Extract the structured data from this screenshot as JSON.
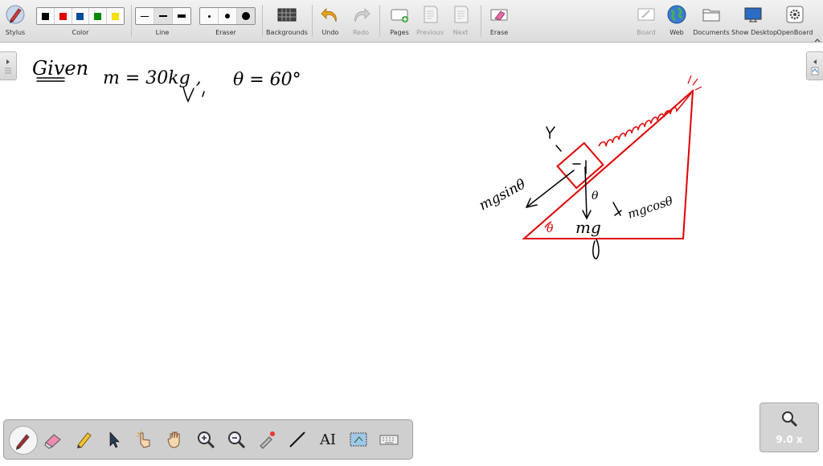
{
  "toolbar": {
    "stylus_label": "Stylus",
    "color_label": "Color",
    "line_label": "Line",
    "eraser_label": "Eraser",
    "backgrounds_label": "Backgrounds",
    "undo_label": "Undo",
    "redo_label": "Redo",
    "pages_label": "Pages",
    "previous_label": "Previous",
    "next_label": "Next",
    "erase_label": "Erase",
    "board_label": "Board",
    "web_label": "Web",
    "documents_label": "Documents",
    "show_desktop_label": "Show Desktop",
    "openboard_label": "OpenBoard",
    "colors": [
      "#000000",
      "#e00000",
      "#004c99",
      "#008a00",
      "#f5e000"
    ],
    "selected_color": "#000000"
  },
  "zoom": {
    "value": "9.0 x",
    "icon": "zoom-magnifier-icon"
  },
  "bottom_tools": [
    {
      "name": "pen-tool",
      "icon": "pen-icon"
    },
    {
      "name": "eraser-tool",
      "icon": "eraser-icon"
    },
    {
      "name": "marker-tool",
      "icon": "marker-icon"
    },
    {
      "name": "selector-tool",
      "icon": "arrow-cursor-icon"
    },
    {
      "name": "interact-tool",
      "icon": "pointing-hand-icon"
    },
    {
      "name": "hand-tool",
      "icon": "hand-icon"
    },
    {
      "name": "zoom-in-tool",
      "icon": "zoom-in-icon"
    },
    {
      "name": "zoom-out-tool",
      "icon": "zoom-out-icon"
    },
    {
      "name": "laser-tool",
      "icon": "laser-pointer-icon"
    },
    {
      "name": "line-tool",
      "icon": "line-icon"
    },
    {
      "name": "text-tool",
      "label": "AI",
      "icon": "text-icon"
    },
    {
      "name": "capture-tool",
      "icon": "capture-icon"
    },
    {
      "name": "keyboard-tool",
      "icon": "keyboard-icon"
    }
  ],
  "board": {
    "given_text": "Given",
    "mass_text": "m = 30kg ,",
    "angle_text": "θ = 60°",
    "label_mgsin": "mgsinθ",
    "label_mgcos": "mgcosθ",
    "label_mg": "mg",
    "label_theta_incline": "θ",
    "label_theta_block": "θ",
    "colors": {
      "ink": "#000000",
      "incline": "#e00000"
    }
  }
}
